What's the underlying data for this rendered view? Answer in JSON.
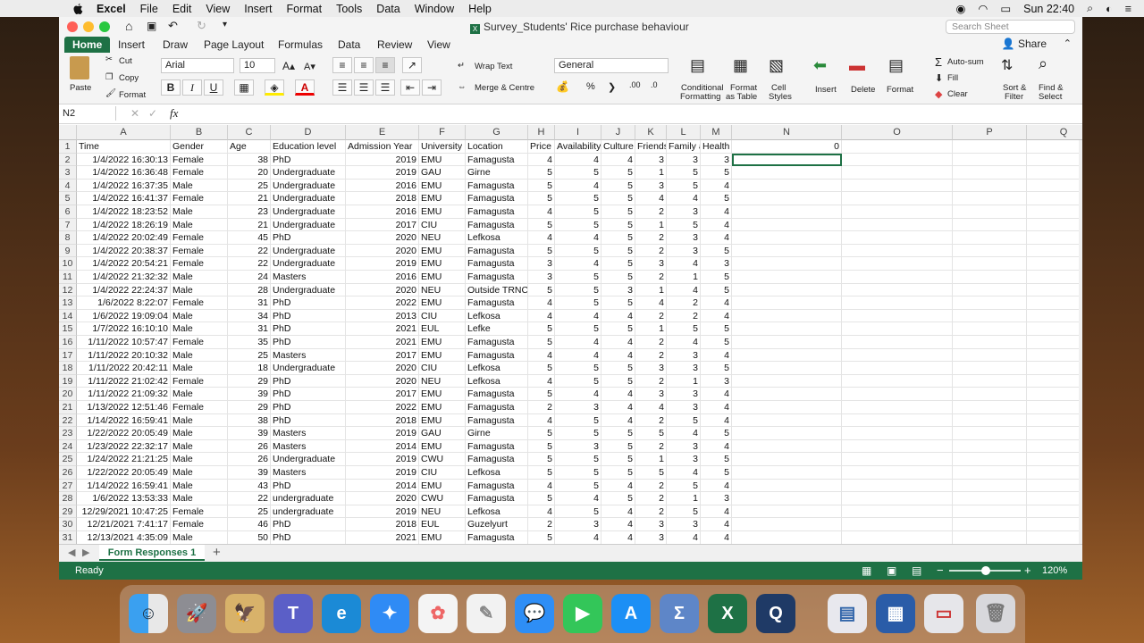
{
  "menubar": {
    "app": "Excel",
    "items": [
      "File",
      "Edit",
      "View",
      "Insert",
      "Format",
      "Tools",
      "Data",
      "Window",
      "Help"
    ],
    "clock": "Sun 22:40"
  },
  "title": {
    "document": "Survey_Students' Rice purchase behaviour",
    "search_placeholder": "Search Sheet"
  },
  "ribbon": {
    "tabs": [
      "Home",
      "Insert",
      "Draw",
      "Page Layout",
      "Formulas",
      "Data",
      "Review",
      "View"
    ],
    "share": "Share",
    "paste": "Paste",
    "cut": "Cut",
    "copy": "Copy",
    "format_painter": "Format",
    "font_name": "Arial",
    "font_size": "10",
    "wrap_text": "Wrap Text",
    "merge_centre": "Merge & Centre",
    "number_format": "General",
    "conditional_formatting_1": "Conditional",
    "conditional_formatting_2": "Formatting",
    "format_as_table_1": "Format",
    "format_as_table_2": "as Table",
    "cell_styles_1": "Cell",
    "cell_styles_2": "Styles",
    "insert": "Insert",
    "delete": "Delete",
    "format": "Format",
    "autosum": "Auto-sum",
    "fill": "Fill",
    "clear": "Clear",
    "sort_filter_1": "Sort &",
    "sort_filter_2": "Filter",
    "find_select_1": "Find &",
    "find_select_2": "Select"
  },
  "formula": {
    "name_box": "N2",
    "fx": "fx",
    "content": ""
  },
  "columns": [
    "A",
    "B",
    "C",
    "D",
    "E",
    "F",
    "G",
    "H",
    "I",
    "J",
    "K",
    "L",
    "M",
    "N",
    "O",
    "P",
    "Q"
  ],
  "headers": [
    "Time",
    "Gender",
    "Age",
    "Education level",
    "Admission Year",
    "University",
    "Location",
    "Price",
    "Availability",
    "Culture",
    "Friends",
    "Family a",
    "Health"
  ],
  "n1_value": "0",
  "rows": [
    [
      "1/4/2022 16:30:13",
      "Female",
      "38",
      "PhD",
      "2019",
      "EMU",
      "Famagusta",
      "4",
      "4",
      "4",
      "3",
      "3",
      "3"
    ],
    [
      "1/4/2022 16:36:48",
      "Female",
      "20",
      "Undergraduate",
      "2019",
      "GAU",
      "Girne",
      "5",
      "5",
      "5",
      "1",
      "5",
      "5"
    ],
    [
      "1/4/2022 16:37:35",
      "Male",
      "25",
      "Undergraduate",
      "2016",
      "EMU",
      "Famagusta",
      "5",
      "4",
      "5",
      "3",
      "5",
      "4"
    ],
    [
      "1/4/2022 16:41:37",
      "Female",
      "21",
      "Undergraduate",
      "2018",
      "EMU",
      "Famagusta",
      "5",
      "5",
      "5",
      "4",
      "4",
      "5"
    ],
    [
      "1/4/2022 18:23:52",
      "Male",
      "23",
      "Undergraduate",
      "2016",
      "EMU",
      "Famagusta",
      "4",
      "5",
      "5",
      "2",
      "3",
      "4"
    ],
    [
      "1/4/2022 18:26:19",
      "Male",
      "21",
      "Undergraduate",
      "2017",
      "CIU",
      "Famagusta",
      "5",
      "5",
      "5",
      "1",
      "5",
      "4"
    ],
    [
      "1/4/2022 20:02:49",
      "Female",
      "45",
      "PhD",
      "2020",
      "NEU",
      "Lefkosa",
      "4",
      "4",
      "5",
      "2",
      "3",
      "4"
    ],
    [
      "1/4/2022 20:38:37",
      "Female",
      "22",
      "Undergraduate",
      "2020",
      "EMU",
      "Famagusta",
      "5",
      "5",
      "5",
      "2",
      "3",
      "5"
    ],
    [
      "1/4/2022 20:54:21",
      "Female",
      "22",
      "Undergraduate",
      "2019",
      "EMU",
      "Famagusta",
      "3",
      "4",
      "5",
      "3",
      "4",
      "3"
    ],
    [
      "1/4/2022 21:32:32",
      "Male",
      "24",
      "Masters",
      "2016",
      "EMU",
      "Famagusta",
      "3",
      "5",
      "5",
      "2",
      "1",
      "5"
    ],
    [
      "1/4/2022 22:24:37",
      "Male",
      "28",
      "Undergraduate",
      "2020",
      "NEU",
      "Outside TRNC",
      "5",
      "5",
      "3",
      "1",
      "4",
      "5"
    ],
    [
      "1/6/2022 8:22:07",
      "Female",
      "31",
      "PhD",
      "2022",
      "EMU",
      "Famagusta",
      "4",
      "5",
      "5",
      "4",
      "2",
      "4"
    ],
    [
      "1/6/2022 19:09:04",
      "Male",
      "34",
      "PhD",
      "2013",
      "CIU",
      "Lefkosa",
      "4",
      "4",
      "4",
      "2",
      "2",
      "4"
    ],
    [
      "1/7/2022 16:10:10",
      "Male",
      "31",
      "PhD",
      "2021",
      "EUL",
      "Lefke",
      "5",
      "5",
      "5",
      "1",
      "5",
      "5"
    ],
    [
      "1/11/2022 10:57:47",
      "Female",
      "35",
      "PhD",
      "2021",
      "EMU",
      "Famagusta",
      "5",
      "4",
      "4",
      "2",
      "4",
      "5"
    ],
    [
      "1/11/2022 20:10:32",
      "Male",
      "25",
      "Masters",
      "2017",
      "EMU",
      "Famagusta",
      "4",
      "4",
      "4",
      "2",
      "3",
      "4"
    ],
    [
      "1/11/2022 20:42:11",
      "Male",
      "18",
      "Undergraduate",
      "2020",
      "CIU",
      "Lefkosa",
      "5",
      "5",
      "5",
      "3",
      "3",
      "5"
    ],
    [
      "1/11/2022 21:02:42",
      "Female",
      "29",
      "PhD",
      "2020",
      "NEU",
      "Lefkosa",
      "4",
      "5",
      "5",
      "2",
      "1",
      "3"
    ],
    [
      "1/11/2022 21:09:32",
      "Male",
      "39",
      "PhD",
      "2017",
      "EMU",
      "Famagusta",
      "5",
      "4",
      "4",
      "3",
      "3",
      "4"
    ],
    [
      "1/13/2022 12:51:46",
      "Female",
      "29",
      "PhD",
      "2022",
      "EMU",
      "Famagusta",
      "2",
      "3",
      "4",
      "4",
      "3",
      "4"
    ],
    [
      "1/14/2022 16:59:41",
      "Male",
      "38",
      "PhD",
      "2018",
      "EMU",
      "Famagusta",
      "4",
      "5",
      "4",
      "2",
      "5",
      "4"
    ],
    [
      "1/22/2022 20:05:49",
      "Male",
      "39",
      "Masters",
      "2019",
      "GAU",
      "Girne",
      "5",
      "5",
      "5",
      "5",
      "4",
      "5"
    ],
    [
      "1/23/2022 22:32:17",
      "Male",
      "26",
      "Masters",
      "2014",
      "EMU",
      "Famagusta",
      "5",
      "3",
      "5",
      "2",
      "3",
      "4"
    ],
    [
      "1/24/2022 21:21:25",
      "Male",
      "26",
      "Undergraduate",
      "2019",
      "CWU",
      "Famagusta",
      "5",
      "5",
      "5",
      "1",
      "3",
      "5"
    ],
    [
      "1/22/2022 20:05:49",
      "Male",
      "39",
      "Masters",
      "2019",
      "CIU",
      "Lefkosa",
      "5",
      "5",
      "5",
      "5",
      "4",
      "5"
    ],
    [
      "1/14/2022 16:59:41",
      "Male",
      "43",
      "PhD",
      "2014",
      "EMU",
      "Famagusta",
      "4",
      "5",
      "4",
      "2",
      "5",
      "4"
    ],
    [
      "1/6/2022 13:53:33",
      "Male",
      "22",
      "undergraduate",
      "2020",
      "CWU",
      "Famagusta",
      "5",
      "4",
      "5",
      "2",
      "1",
      "3"
    ],
    [
      "12/29/2021 10:47:25",
      "Female",
      "25",
      "undergraduate",
      "2019",
      "NEU",
      "Lefkosa",
      "4",
      "5",
      "4",
      "2",
      "5",
      "4"
    ],
    [
      "12/21/2021 7:41:17",
      "Female",
      "46",
      "PhD",
      "2018",
      "EUL",
      "Guzelyurt",
      "2",
      "3",
      "4",
      "3",
      "3",
      "4"
    ],
    [
      "12/13/2021 4:35:09",
      "Male",
      "50",
      "PhD",
      "2021",
      "EMU",
      "Famagusta",
      "5",
      "4",
      "4",
      "3",
      "4",
      "4"
    ]
  ],
  "sheet_tab": "Form Responses 1",
  "status": {
    "ready": "Ready",
    "zoom": "120%"
  },
  "colors": {
    "excel_green": "#1e7145"
  }
}
